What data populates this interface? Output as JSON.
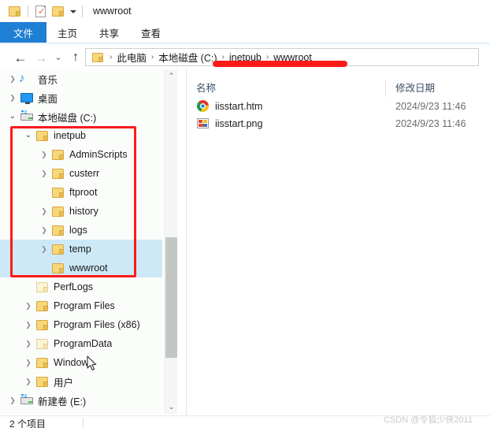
{
  "window": {
    "title": "wwwroot",
    "quick_access": [
      {
        "name": "folder-icon",
        "label": ""
      },
      {
        "name": "properties-icon",
        "label": ""
      },
      {
        "name": "new-folder-icon",
        "label": ""
      },
      {
        "name": "customize-caret-icon",
        "label": ""
      }
    ]
  },
  "ribbon": {
    "tabs": [
      {
        "label": "文件",
        "active": true
      },
      {
        "label": "主页",
        "active": false
      },
      {
        "label": "共享",
        "active": false
      },
      {
        "label": "查看",
        "active": false
      }
    ]
  },
  "addressbar": {
    "back_icon": "←",
    "forward_icon": "→",
    "history_icon": "⌄",
    "up_icon": "↑",
    "separator": "›",
    "crumbs": [
      "此电脑",
      "本地磁盘 (C:)",
      "inetpub",
      "wwwroot"
    ]
  },
  "tree": {
    "collapse_icon": "⌃",
    "scroll_up_icon": "⌃",
    "scroll_down_icon": "⌄",
    "items": [
      {
        "label": "音乐",
        "indent": 0,
        "twisty": "collapsed",
        "icon": "music-icon",
        "selected": false
      },
      {
        "label": "桌面",
        "indent": 0,
        "twisty": "collapsed",
        "icon": "desktop-icon",
        "selected": false
      },
      {
        "label": "本地磁盘 (C:)",
        "indent": 0,
        "twisty": "expanded",
        "icon": "drive-icon",
        "selected": false
      },
      {
        "label": "inetpub",
        "indent": 1,
        "twisty": "expanded",
        "icon": "folder-icon",
        "selected": false
      },
      {
        "label": "AdminScripts",
        "indent": 2,
        "twisty": "collapsed",
        "icon": "folder-icon",
        "selected": false
      },
      {
        "label": "custerr",
        "indent": 2,
        "twisty": "collapsed",
        "icon": "folder-icon",
        "selected": false
      },
      {
        "label": "ftproot",
        "indent": 2,
        "twisty": "none",
        "icon": "folder-icon",
        "selected": false
      },
      {
        "label": "history",
        "indent": 2,
        "twisty": "collapsed",
        "icon": "folder-icon",
        "selected": false
      },
      {
        "label": "logs",
        "indent": 2,
        "twisty": "collapsed",
        "icon": "folder-icon",
        "selected": false
      },
      {
        "label": "temp",
        "indent": 2,
        "twisty": "collapsed",
        "icon": "folder-icon",
        "selected": true
      },
      {
        "label": "wwwroot",
        "indent": 2,
        "twisty": "none",
        "icon": "folder-icon",
        "selected": true
      },
      {
        "label": "PerfLogs",
        "indent": 1,
        "twisty": "none",
        "icon": "folder-pale",
        "selected": false
      },
      {
        "label": "Program Files",
        "indent": 1,
        "twisty": "collapsed",
        "icon": "folder-icon",
        "selected": false
      },
      {
        "label": "Program Files (x86)",
        "indent": 1,
        "twisty": "collapsed",
        "icon": "folder-icon",
        "selected": false
      },
      {
        "label": "ProgramData",
        "indent": 1,
        "twisty": "collapsed",
        "icon": "folder-pale",
        "selected": false
      },
      {
        "label": "Windows",
        "indent": 1,
        "twisty": "collapsed",
        "icon": "folder-icon",
        "selected": false
      },
      {
        "label": "用户",
        "indent": 1,
        "twisty": "collapsed",
        "icon": "folder-icon",
        "selected": false
      },
      {
        "label": "新建卷 (E:)",
        "indent": 0,
        "twisty": "collapsed",
        "icon": "drive-icon",
        "selected": false
      }
    ]
  },
  "filelist": {
    "columns": [
      "名称",
      "修改日期"
    ],
    "rows": [
      {
        "name": "iisstart.htm",
        "icon": "chrome-icon",
        "date": "2024/9/23 11:46"
      },
      {
        "name": "iisstart.png",
        "icon": "image-icon",
        "date": "2024/9/23 11:46"
      }
    ]
  },
  "statusbar": {
    "item_count": "2 个项目"
  },
  "annotations": {
    "color": "#ff1a1a",
    "box_target": "inetpub-subtree",
    "line_target": "wwwroot-breadcrumb"
  },
  "watermark": {
    "text": "CSDN @令狐少侠2011"
  }
}
